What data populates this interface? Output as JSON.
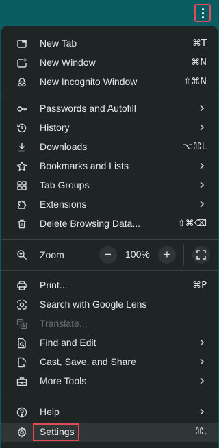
{
  "menu": {
    "sections": [
      [
        {
          "label": "New Tab",
          "shortcut": "⌘T",
          "icon": "new-tab-icon"
        },
        {
          "label": "New Window",
          "shortcut": "⌘N",
          "icon": "new-window-icon"
        },
        {
          "label": "New Incognito Window",
          "shortcut": "⇧⌘N",
          "icon": "incognito-icon"
        }
      ],
      [
        {
          "label": "Passwords and Autofill",
          "icon": "key-icon",
          "submenu": true
        },
        {
          "label": "History",
          "icon": "history-icon",
          "submenu": true
        },
        {
          "label": "Downloads",
          "shortcut": "⌥⌘L",
          "icon": "download-icon"
        },
        {
          "label": "Bookmarks and Lists",
          "icon": "star-icon",
          "submenu": true
        },
        {
          "label": "Tab Groups",
          "icon": "tab-groups-icon",
          "submenu": true
        },
        {
          "label": "Extensions",
          "icon": "extensions-icon",
          "submenu": true
        },
        {
          "label": "Delete Browsing Data...",
          "shortcut": "⇧⌘⌫",
          "icon": "trash-icon"
        }
      ]
    ],
    "zoom": {
      "label": "Zoom",
      "value": "100%",
      "minus": "−",
      "plus": "+"
    },
    "section3": [
      {
        "label": "Print...",
        "shortcut": "⌘P",
        "icon": "print-icon"
      },
      {
        "label": "Search with Google Lens",
        "icon": "lens-icon"
      },
      {
        "label": "Translate...",
        "icon": "translate-icon",
        "disabled": true
      },
      {
        "label": "Find and Edit",
        "icon": "find-icon",
        "submenu": true
      },
      {
        "label": "Cast, Save, and Share",
        "icon": "cast-icon",
        "submenu": true
      },
      {
        "label": "More Tools",
        "icon": "toolbox-icon",
        "submenu": true
      }
    ],
    "section4": [
      {
        "label": "Help",
        "icon": "help-icon",
        "submenu": true
      },
      {
        "label": "Settings",
        "shortcut": "⌘,",
        "icon": "gear-icon"
      }
    ]
  },
  "colors": {
    "highlight": "#e14a5a",
    "menu_bg": "#1f2524",
    "accent_bg": "#0a5c63"
  }
}
